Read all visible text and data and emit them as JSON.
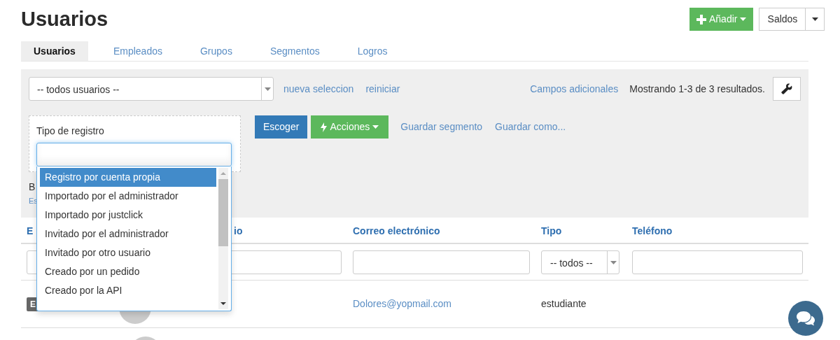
{
  "page": {
    "title": "Usuarios"
  },
  "header_buttons": {
    "add": "Añadir",
    "balances": "Saldos"
  },
  "tabs": [
    {
      "label": "Usuarios",
      "selected": true
    },
    {
      "label": "Empleados",
      "selected": false
    },
    {
      "label": "Grupos",
      "selected": false
    },
    {
      "label": "Segmentos",
      "selected": false
    },
    {
      "label": "Logros",
      "selected": false
    }
  ],
  "toolbar": {
    "segment_select": {
      "value": "-- todos usuarios --"
    },
    "links": [
      "nueva seleccion",
      "reiniciar"
    ],
    "extra_fields_link": "Campos adicionales",
    "results_text": "Mostrando 1-3 de 3 resultados."
  },
  "filter": {
    "label": "Tipo de registro",
    "dropdown": {
      "expanded": true,
      "options": [
        {
          "label": "Registro por cuenta propia",
          "selected": true
        },
        {
          "label": "Importado por el administrador",
          "selected": false
        },
        {
          "label": "Importado por justclick",
          "selected": false
        },
        {
          "label": "Invitado por el administrador",
          "selected": false
        },
        {
          "label": "Invitado por otro usuario",
          "selected": false
        },
        {
          "label": "Creado por un pedido",
          "selected": false
        },
        {
          "label": "Creado por la API",
          "selected": false
        }
      ]
    }
  },
  "actions": {
    "choose_button": "Escoger",
    "actions_button": "Acciones",
    "links": [
      "Guardar segmento",
      "Guardar como..."
    ]
  },
  "filter_note": {
    "label": "B",
    "link": "Es"
  },
  "table": {
    "columns": [
      "E",
      "io",
      "Correo electrónico",
      "Tipo",
      "Teléfono"
    ],
    "filters": [
      {
        "kind": "text"
      },
      {
        "kind": "text"
      },
      {
        "kind": "text"
      },
      {
        "kind": "select",
        "value": "-- todos --"
      },
      {
        "kind": "text"
      }
    ],
    "rows": [
      {
        "kind": "full",
        "badge": "E",
        "email": "Dolores@yopmail.com",
        "type": "estudiante"
      },
      {
        "kind": "cut"
      }
    ]
  }
}
